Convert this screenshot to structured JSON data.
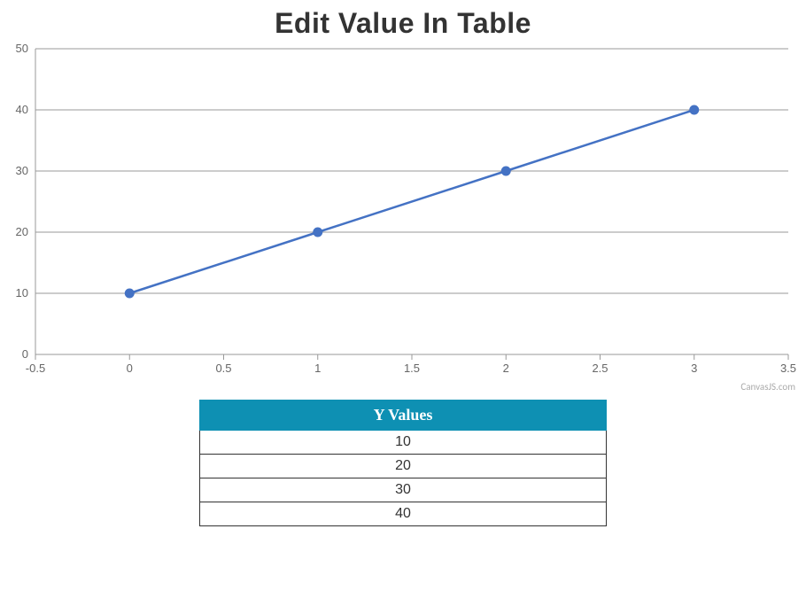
{
  "chart_data": {
    "type": "line",
    "title": "Edit Value In Table",
    "x": [
      0,
      1,
      2,
      3
    ],
    "values": [
      10,
      20,
      30,
      40
    ],
    "xlabel": "",
    "ylabel": "",
    "xlim": [
      -0.5,
      3.5
    ],
    "ylim": [
      0,
      50
    ],
    "x_ticks": [
      -0.5,
      0,
      0.5,
      1,
      1.5,
      2,
      2.5,
      3,
      3.5
    ],
    "y_ticks": [
      0,
      10,
      20,
      30,
      40,
      50
    ]
  },
  "table": {
    "header": "Y Values",
    "rows": [
      10,
      20,
      30,
      40
    ]
  },
  "credit": "CanvasJS.com"
}
